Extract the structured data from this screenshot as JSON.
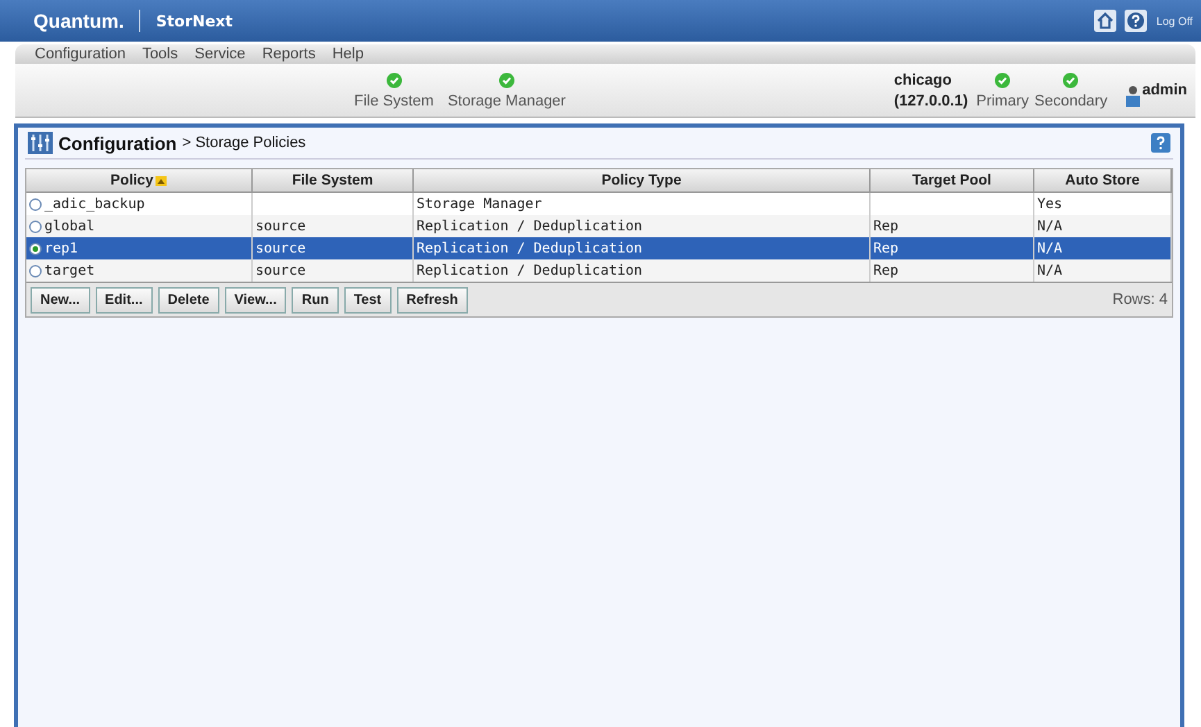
{
  "brand": {
    "logo": "Quantum.",
    "product": "StorNext",
    "logoff": "Log Off"
  },
  "menu": [
    "Configuration",
    "Tools",
    "Service",
    "Reports",
    "Help"
  ],
  "services": [
    {
      "label": "File System",
      "ok": true
    },
    {
      "label": "Storage Manager",
      "ok": true
    }
  ],
  "server": {
    "name": "chicago",
    "address": "(127.0.0.1)",
    "nodes": [
      {
        "label": "Primary",
        "ok": true
      },
      {
        "label": "Secondary",
        "ok": true
      }
    ],
    "user": "admin"
  },
  "breadcrumb": {
    "root": "Configuration",
    "page": "> Storage Policies"
  },
  "table": {
    "columns": [
      {
        "label": "Policy",
        "sorted": true
      },
      {
        "label": "File System",
        "sorted": false
      },
      {
        "label": "Policy Type",
        "sorted": false
      },
      {
        "label": "Target Pool",
        "sorted": false
      },
      {
        "label": "Auto Store",
        "sorted": false
      }
    ],
    "rows": [
      {
        "selected": false,
        "cells": [
          "_adic_backup",
          "",
          "Storage Manager",
          "",
          "Yes"
        ]
      },
      {
        "selected": false,
        "cells": [
          "global",
          "source",
          "Replication / Deduplication",
          "Rep",
          "N/A"
        ]
      },
      {
        "selected": true,
        "cells": [
          "rep1",
          "source",
          "Replication / Deduplication",
          "Rep",
          "N/A"
        ]
      },
      {
        "selected": false,
        "cells": [
          "target",
          "source",
          "Replication / Deduplication",
          "Rep",
          "N/A"
        ]
      }
    ]
  },
  "buttons": [
    "New...",
    "Edit...",
    "Delete",
    "View...",
    "Run",
    "Test",
    "Refresh"
  ],
  "row_count": "Rows: 4"
}
